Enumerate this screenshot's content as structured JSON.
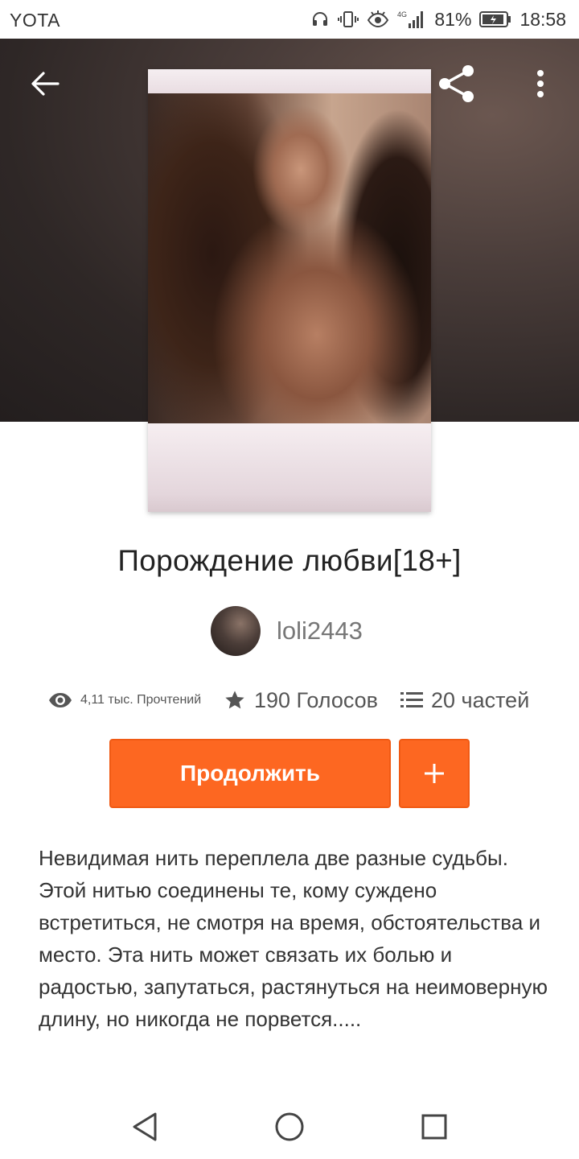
{
  "status_bar": {
    "carrier": "YOTA",
    "network": "4G",
    "battery": "81%",
    "time": "18:58",
    "icons": [
      "headphones-icon",
      "vibrate-icon",
      "eye-comfort-icon",
      "signal-icon",
      "battery-icon"
    ]
  },
  "header": {
    "icons": {
      "back": "arrow-left-icon",
      "share": "share-icon",
      "more": "more-vertical-icon"
    }
  },
  "story": {
    "title": "Порождение любви[18+]",
    "author": "loli2443",
    "stats": {
      "reads": "4,11 тыс. Прочтений",
      "votes": "190 Голосов",
      "parts": "20 частей"
    },
    "continue_label": "Продолжить",
    "add_icon": "plus-icon",
    "description": "Невидимая нить переплела две разные судьбы. Этой нитью соединены те, кому суждено встретиться, не смотря на время, обстоятельства и место. Эта нить может связать их болью и радостью, запутаться, растянуться на неимоверную длину, но никогда не порвется....."
  },
  "nav_bar": {
    "icons": [
      "triangle-back-icon",
      "circle-home-icon",
      "square-recents-icon"
    ]
  },
  "colors": {
    "accent": "#fd6721",
    "header_bg": "#2e2726",
    "text": "#333333",
    "muted": "#777777"
  }
}
